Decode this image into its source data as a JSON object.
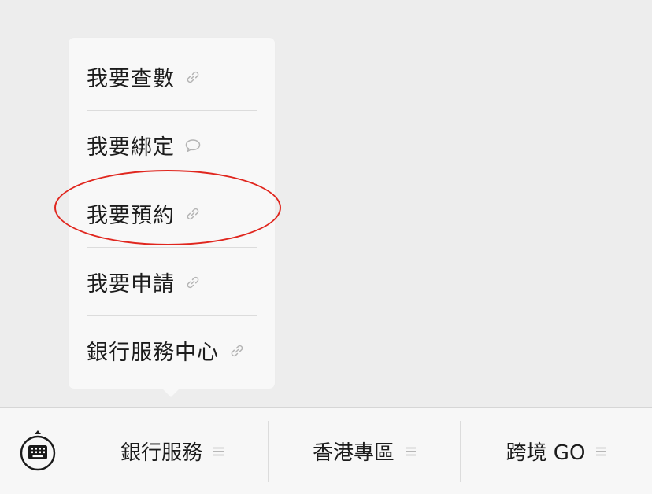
{
  "popup_menu": {
    "items": [
      {
        "label": "我要查數",
        "icon": "link-icon"
      },
      {
        "label": "我要綁定",
        "icon": "chat-bubble-icon"
      },
      {
        "label": "我要預約",
        "icon": "link-icon"
      },
      {
        "label": "我要申請",
        "icon": "link-icon"
      },
      {
        "label": "銀行服務中心",
        "icon": "link-icon"
      }
    ],
    "highlighted_item": "我要預約",
    "highlight_color": "#e0261e"
  },
  "bottom_bar": {
    "keyboard_icon": "keyboard-icon",
    "tabs": [
      {
        "label": "銀行服務",
        "icon": "menu-lines-icon"
      },
      {
        "label": "香港專區",
        "icon": "menu-lines-icon"
      },
      {
        "label": "跨境 GO",
        "icon": "menu-lines-icon"
      }
    ]
  }
}
